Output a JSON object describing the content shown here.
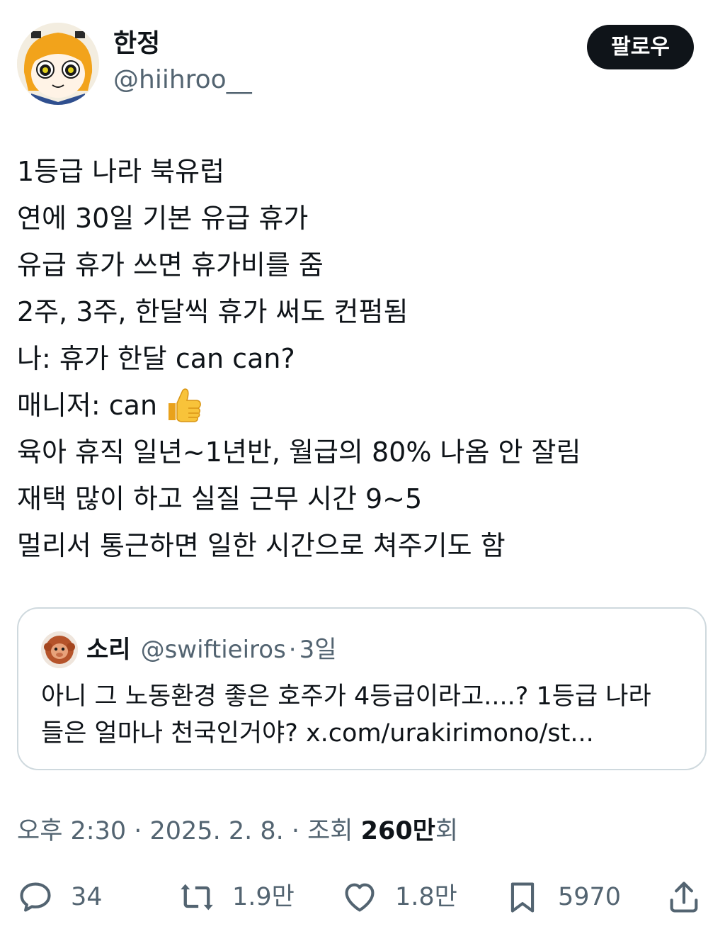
{
  "author": {
    "name": "한정",
    "handle": "@hiihroo__",
    "follow_label": "팔로우"
  },
  "post": {
    "lines": [
      "1등급 나라 북유럽",
      "연에 30일 기본 유급 휴가",
      "유급 휴가 쓰면 휴가비를 줌",
      "2주, 3주, 한달씩 휴가 써도 컨펌됨",
      "나: 휴가 한달 can can?",
      "매니저: can",
      "육아 휴직 일년~1년반, 월급의 80% 나옴 안 잘림",
      "재택 많이 하고 실질 근무 시간 9~5",
      "멀리서 통근하면 일한 시간으로 쳐주기도 함"
    ],
    "emoji": "thumbs-up-icon"
  },
  "quote": {
    "name": "소리",
    "handle": "@swiftieiros",
    "separator": "·",
    "time": "3일",
    "lines": [
      "아니 그 노동환경 좋은 호주가 4등급이라고....?  1등급 나라",
      "들은 얼마나 천국인거야? x.com/urakirimono/st..."
    ]
  },
  "meta": {
    "time_date": "오후 2:30 · 2025. 2. 8. · 조회 ",
    "views_count": "260만",
    "views_suffix": "회"
  },
  "actions": {
    "reply": {
      "icon": "reply-icon",
      "count": "34"
    },
    "repost": {
      "icon": "repost-icon",
      "count": "1.9만"
    },
    "like": {
      "icon": "heart-icon",
      "count": "1.8만"
    },
    "bookmark": {
      "icon": "bookmark-icon",
      "count": "5970"
    },
    "share": {
      "icon": "share-icon"
    }
  },
  "colors": {
    "text": "#0f1419",
    "secondary": "#536471",
    "border": "#cfd9de",
    "follow_bg": "#0f1419"
  }
}
